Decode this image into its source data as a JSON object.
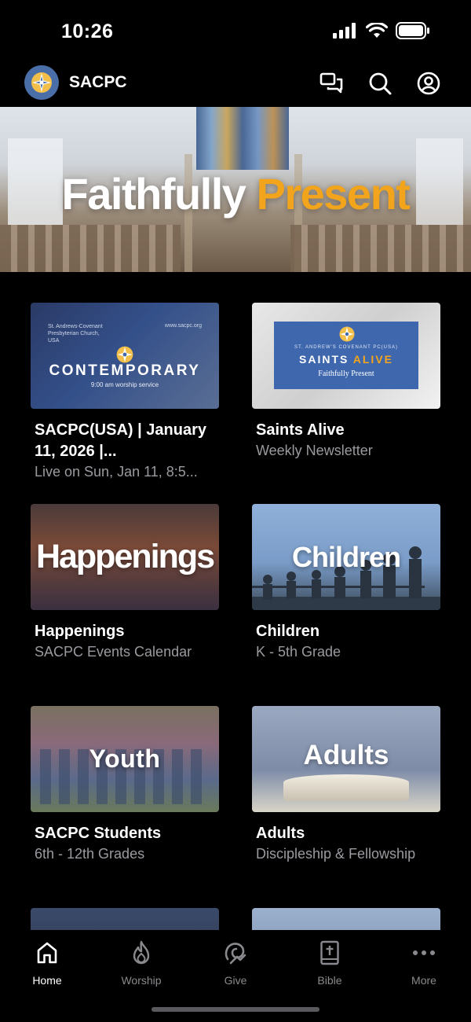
{
  "status_bar": {
    "time": "10:26"
  },
  "header": {
    "title": "SACPC"
  },
  "hero": {
    "word1": "Faithfully",
    "word2": "Present"
  },
  "cards": [
    {
      "title": "SACPC(USA) | January 11, 2026 |...",
      "subtitle": "Live on Sun, Jan 11, 8:5...",
      "thumb": {
        "org_line": "St. Andrews-Covenant Presbyterian Church, USA",
        "site": "www.sacpc.org",
        "big": "CONTEMPORARY",
        "small": "9:00 am worship service"
      }
    },
    {
      "title": "Saints Alive",
      "subtitle": "Weekly Newsletter",
      "thumb": {
        "org_line": "ST. ANDREW'S COVENANT PC(USA)",
        "big_a": "SAINTS ",
        "big_b": "ALIVE",
        "small": "Faithfully Present"
      }
    },
    {
      "title": "Happenings",
      "subtitle": "SACPC Events Calendar",
      "thumb": {
        "big": "Happenings"
      }
    },
    {
      "title": "Children",
      "subtitle": "K - 5th Grade",
      "thumb": {
        "big": "Children"
      }
    },
    {
      "title": "SACPC Students",
      "subtitle": "6th - 12th Grades",
      "thumb": {
        "big": "Youth"
      }
    },
    {
      "title": "Adults",
      "subtitle": "Discipleship & Fellowship",
      "thumb": {
        "big": "Adults"
      }
    }
  ],
  "tabs": [
    {
      "label": "Home",
      "icon": "home-icon",
      "active": true
    },
    {
      "label": "Worship",
      "icon": "flame-icon",
      "active": false
    },
    {
      "label": "Give",
      "icon": "give-icon",
      "active": false
    },
    {
      "label": "Bible",
      "icon": "bible-icon",
      "active": false
    },
    {
      "label": "More",
      "icon": "more-icon",
      "active": false
    }
  ],
  "colors": {
    "accent": "#f2a51c",
    "background": "#000000",
    "muted_text": "#9a9aa0",
    "logo_bg": "#4a6fa8"
  }
}
